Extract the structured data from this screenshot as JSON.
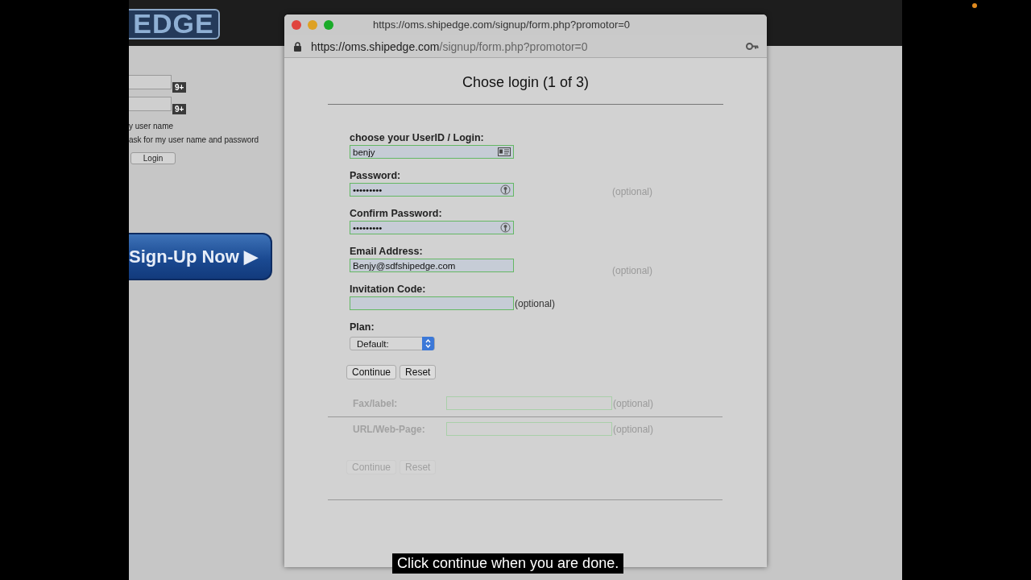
{
  "background_page": {
    "logo": "EDGE",
    "login_fields": [
      {
        "badge": "9+"
      },
      {
        "badge": "9+"
      }
    ],
    "remember_text": "y user name",
    "ask_text": "ask for my user name and password",
    "login_button": "Login",
    "signup_banner": {
      "label": "Sign-Up Now",
      "arrow": "▶"
    }
  },
  "window": {
    "title": "https://oms.shipedge.com/signup/form.php?promotor=0",
    "address": {
      "host": "https://oms.shipedge.com",
      "path": "/signup/form.php?promotor=0",
      "secure": true
    }
  },
  "form": {
    "heading": "Chose login (1 of 3)",
    "fields": [
      {
        "kind": "login",
        "label": "choose your UserID / Login:",
        "value": "benjy"
      },
      {
        "kind": "password",
        "label": "Password:",
        "value": "•••••••••"
      },
      {
        "kind": "password",
        "label": "Confirm Password:",
        "value": "•••••••••"
      },
      {
        "kind": "email",
        "label": "Email Address:",
        "value": "Benjy@sdfshipedge.com"
      },
      {
        "kind": "code",
        "label": "Invitation Code:",
        "note": "(optional)"
      },
      {
        "kind": "select",
        "label": "Plan:",
        "value": "Default:"
      }
    ],
    "buttons": [
      "Continue",
      "Reset"
    ]
  },
  "faded_form": {
    "side_notes": [
      "(optional)",
      "(optional)"
    ],
    "rows": [
      {
        "label": "Fax/label:",
        "note": "(optional)"
      },
      {
        "label": "URL/Web-Page:",
        "note": "(optional)"
      }
    ],
    "buttons": [
      "Continue",
      "Reset"
    ]
  },
  "caption": "Click continue when you are done."
}
